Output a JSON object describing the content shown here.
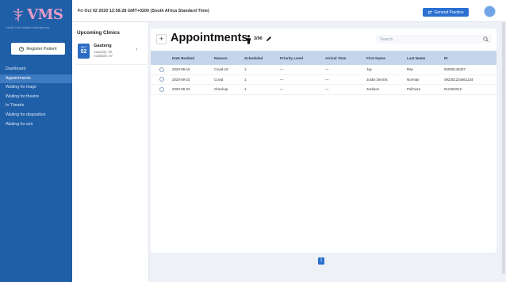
{
  "app": {
    "logo": "VMS",
    "logo_sub": "Health Care Intelligent Management",
    "colors": {
      "sidebar": "#1f5fa8",
      "accent": "#2a6fd1",
      "header_row": "#c5d6ec",
      "logo": "#e89bc8"
    }
  },
  "sidebar": {
    "register_label": "Register Patient",
    "items": [
      {
        "label": "Dashboard"
      },
      {
        "label": "Appointments"
      },
      {
        "label": "Waiting for triage"
      },
      {
        "label": "Waiting for theatre"
      },
      {
        "label": "In Theatre"
      },
      {
        "label": "Waiting for disposition"
      },
      {
        "label": "Waiting for exit"
      }
    ]
  },
  "topbar": {
    "datetime": "Fri Oct 02 2020 12:58:28 GMT+0200 (South Africa Standard Time)",
    "practice_label": "General Practice",
    "practice_icon": "swap-icon"
  },
  "clinics": {
    "title": "Upcoming Clinics",
    "items": [
      {
        "month": "OCT",
        "day": "02",
        "name": "Gauteng",
        "capacity": "Capacity: 90",
        "available": "Available: 87"
      }
    ]
  },
  "main": {
    "title": "Appointments",
    "count": "3/90",
    "search_placeholder": "Search",
    "columns": [
      "",
      "Date Booked",
      "Reason",
      "Scheduled",
      "Priority Level",
      "Arrival Time",
      "First Name",
      "Last Name",
      "ID"
    ],
    "rows": [
      {
        "date": "2020-09-16",
        "reason": "Covid-19",
        "scheduled": "1",
        "priority": "—",
        "arrival": "—",
        "first": "Jay",
        "last": "Rae",
        "id": "92090145337"
      },
      {
        "date": "2020-09-23",
        "reason": "Covid",
        "scheduled": "1",
        "priority": "—",
        "arrival": "—",
        "first": "Justin Derrick",
        "last": "Norman",
        "id": "092301234561234"
      },
      {
        "date": "2020-09-23",
        "reason": "Checkup",
        "scheduled": "1",
        "priority": "—",
        "arrival": "—",
        "first": "Jackson",
        "last": "Pollmore",
        "id": "012364012"
      }
    ],
    "page": "1"
  }
}
